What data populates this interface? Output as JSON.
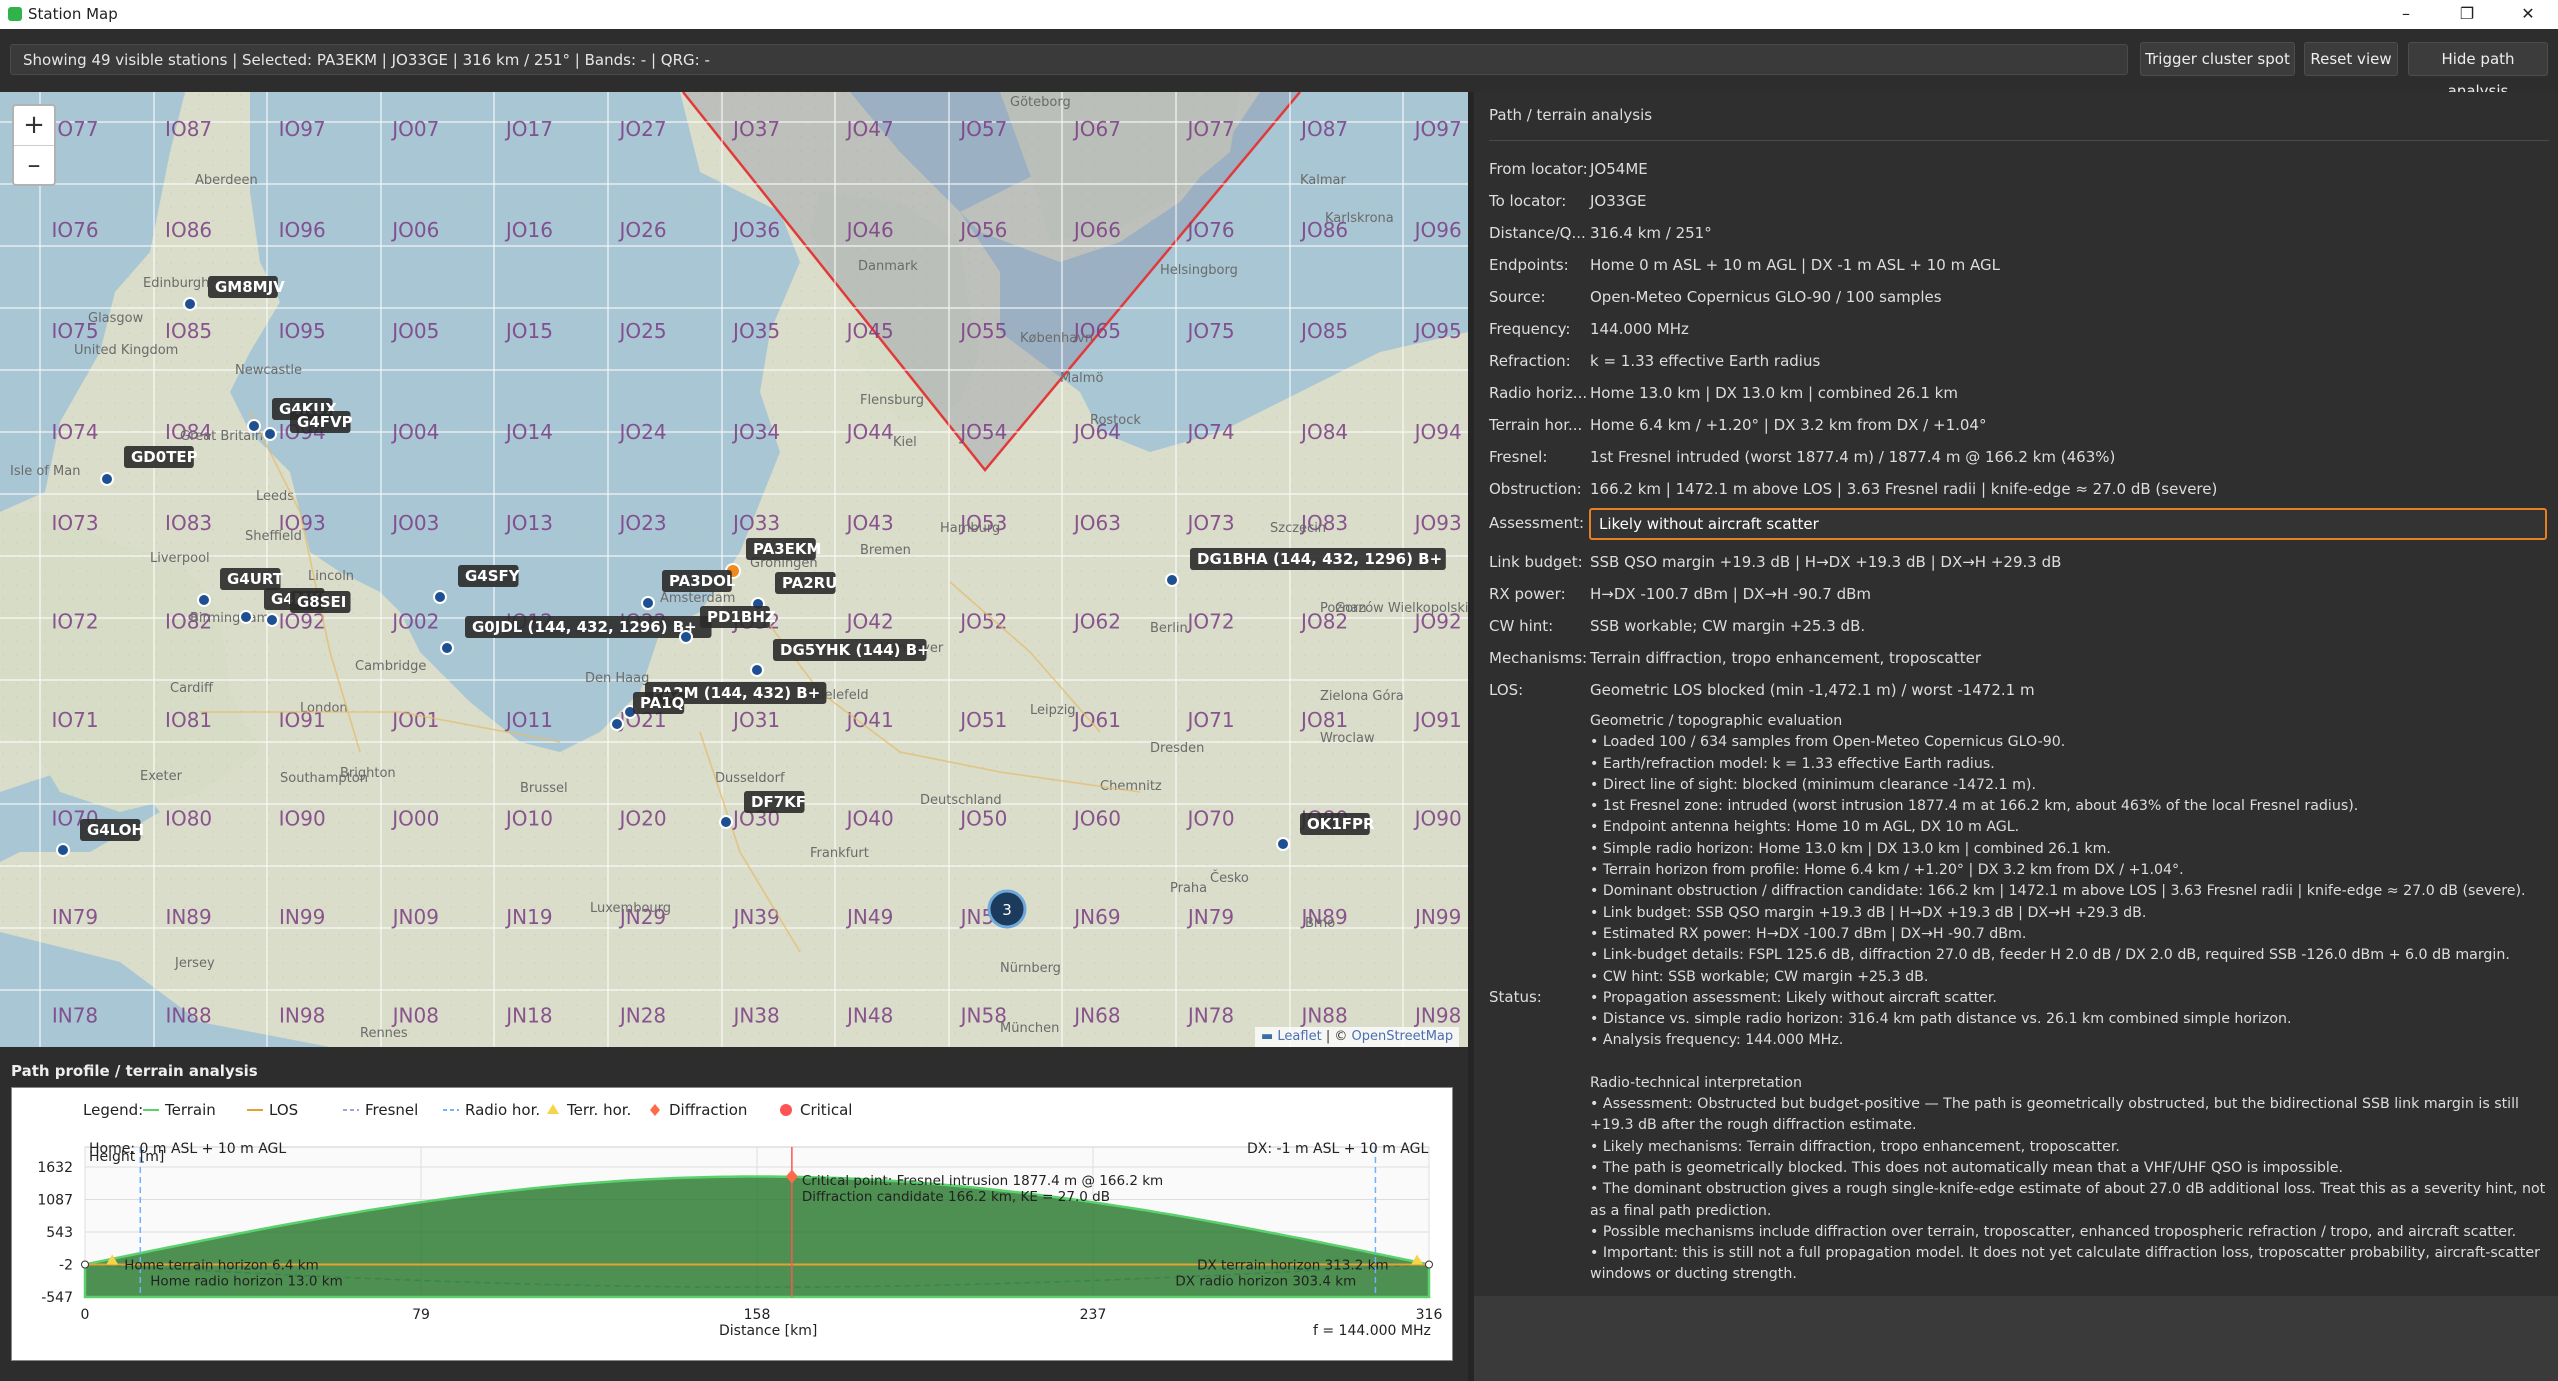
{
  "window": {
    "title": "Station Map",
    "minimize": "–",
    "maximize": "❐",
    "close": "✕"
  },
  "toolbar": {
    "status": "Showing 49 visible stations | Selected: PA3EKM | JO33GE | 316 km / 251° | Bands: - | QRG: -",
    "buttons": [
      "Trigger cluster spot",
      "Reset view",
      "Hide path analysis"
    ]
  },
  "map": {
    "zoom_in": "+",
    "zoom_out": "–",
    "attribution_leaflet": "Leaflet",
    "attribution_sep": " | © ",
    "attribution_osm": "OpenStreetMap",
    "grid_rows": [
      [
        "IO77",
        "IO87",
        "IO97",
        "JO07",
        "JO17",
        "JO27",
        "JO37",
        "JO47",
        "JO57",
        "JO67",
        "JO77",
        "JO87",
        "JO97"
      ],
      [
        "IO76",
        "IO86",
        "IO96",
        "JO06",
        "JO16",
        "JO26",
        "JO36",
        "JO46",
        "JO56",
        "JO66",
        "JO76",
        "JO86",
        "JO96"
      ],
      [
        "IO75",
        "IO85",
        "IO95",
        "JO05",
        "JO15",
        "JO25",
        "JO35",
        "JO45",
        "JO55",
        "JO65",
        "JO75",
        "JO85",
        "JO95"
      ],
      [
        "IO74",
        "IO84",
        "IO94",
        "JO04",
        "JO14",
        "JO24",
        "JO34",
        "JO44",
        "JO54",
        "JO64",
        "JO74",
        "JO84",
        "JO94"
      ],
      [
        "IO73",
        "IO83",
        "IO93",
        "JO03",
        "JO13",
        "JO23",
        "JO33",
        "JO43",
        "JO53",
        "JO63",
        "JO73",
        "JO83",
        "JO93"
      ],
      [
        "IO72",
        "IO82",
        "IO92",
        "JO02",
        "JO12",
        "JO22",
        "JO32",
        "JO42",
        "JO52",
        "JO62",
        "JO72",
        "JO82",
        "JO92"
      ],
      [
        "IO71",
        "IO81",
        "IO91",
        "JO01",
        "JO11",
        "JO21",
        "JO31",
        "JO41",
        "JO51",
        "JO61",
        "JO71",
        "JO81",
        "JO91"
      ],
      [
        "IO70",
        "IO80",
        "IO90",
        "JO00",
        "JO10",
        "JO20",
        "JO30",
        "JO40",
        "JO50",
        "JO60",
        "JO70",
        "JO80",
        "JO90"
      ],
      [
        "IN79",
        "IN89",
        "IN99",
        "JN09",
        "JN19",
        "JN29",
        "JN39",
        "JN49",
        "JN59",
        "JN69",
        "JN79",
        "JN89",
        "JN99"
      ],
      [
        "IN78",
        "IN88",
        "IN98",
        "JN08",
        "JN18",
        "JN28",
        "JN38",
        "JN48",
        "JN58",
        "JN68",
        "JN78",
        "JN88",
        "JN98"
      ]
    ],
    "places": [
      "Aberdeen",
      "Edinburgh",
      "Glasgow",
      "United Kingdom",
      "Newcastle",
      "Isle of Man",
      "Great Britain",
      "Leeds",
      "Liverpool",
      "Sheffield",
      "Lincoln",
      "Birmingham",
      "Cambridge",
      "Cardiff",
      "London",
      "Brighton",
      "Southampton",
      "Exeter",
      "Rennes",
      "Jersey",
      "Göteborg",
      "Danmark",
      "Helsingborg",
      "København",
      "Flensburg",
      "Kiel",
      "Hamburg",
      "Bremen",
      "Groningen",
      "Amsterdam",
      "Den Haag",
      "Bielefeld",
      "Dusseldorf",
      "Deutschland",
      "Leipzig",
      "Dresden",
      "Berlin",
      "Chemnitz",
      "Praha",
      "Nürnberg",
      "Frankfurt",
      "München",
      "Luxembourg",
      "Brussel",
      "Wroclaw",
      "Poznan",
      "Szczecin",
      "Gorzów Wielkopolski",
      "Zielona Góra",
      "Kalmar",
      "Karlskrona",
      "Malmö",
      "Rostock",
      "Hannover",
      "Česko",
      "Brno"
    ],
    "stations": [
      {
        "call": "GM8MJV"
      },
      {
        "call": "G4KUX"
      },
      {
        "call": "G4FVP"
      },
      {
        "call": "GD0TEP"
      },
      {
        "call": "G4URT"
      },
      {
        "call": "G4MKB"
      },
      {
        "call": "G8SEI"
      },
      {
        "call": "G4SFY"
      },
      {
        "call": "G0JDL (144, 432, 1296) B+"
      },
      {
        "call": "PA3EKM"
      },
      {
        "call": "PA3DOL"
      },
      {
        "call": "PA2RU"
      },
      {
        "call": "PD1BHZ"
      },
      {
        "call": "DG5YHK (144) B+"
      },
      {
        "call": "PA2M (144, 432) B+"
      },
      {
        "call": "PA1Q"
      },
      {
        "call": "DF7KF"
      },
      {
        "call": "G4LOH"
      },
      {
        "call": "DG1BHA (144, 432, 1296) B+"
      },
      {
        "call": "OK1FPR"
      }
    ],
    "cluster_count": "3"
  },
  "profile": {
    "title": "Path profile / terrain analysis",
    "legend_label": "Legend:",
    "legend": [
      {
        "name": "Terrain",
        "color": "#5bd16e",
        "style": "solid"
      },
      {
        "name": "LOS",
        "color": "#e8a030",
        "style": "solid"
      },
      {
        "name": "Fresnel",
        "color": "#9aa7d6",
        "style": "dashed"
      },
      {
        "name": "Radio hor.",
        "color": "#6fb3ff",
        "style": "dashed"
      },
      {
        "name": "Terr. hor.",
        "color": "#f5d44a",
        "style": "triangle"
      },
      {
        "name": "Diffraction",
        "color": "#ff6b4a",
        "style": "diamond"
      },
      {
        "name": "Critical",
        "color": "#ff5555",
        "style": "dot"
      }
    ],
    "home_label": "Home: 0 m ASL + 10 m AGL",
    "dx_label": "DX: -1 m ASL + 10 m AGL",
    "height_label": "Height [m]",
    "y_ticks": [
      "1632",
      "1087",
      "543",
      "-2",
      "-547"
    ],
    "x_ticks": [
      "0",
      "79",
      "158",
      "237",
      "316"
    ],
    "xlabel": "Distance [km]",
    "freq": "f = 144.000 MHz",
    "critical1": "Critical point: Fresnel intrusion 1877.4 m @ 166.2 km",
    "critical2": "Diffraction candidate 166.2 km, KE = 27.0 dB",
    "home_terr": "Home terrain horizon 6.4 km",
    "home_radio": "Home radio horizon 13.0 km",
    "dx_terr": "DX terrain horizon 313.2 km",
    "dx_radio": "DX radio horizon 303.4 km"
  },
  "analysis": {
    "title": "Path / terrain analysis",
    "rows": [
      {
        "label": "From locator:",
        "value": "JO54ME"
      },
      {
        "label": "To locator:",
        "value": "JO33GE"
      },
      {
        "label": "Distance/Q...",
        "value": "316.4 km / 251°"
      },
      {
        "label": "Endpoints:",
        "value": "Home 0 m ASL + 10 m AGL | DX -1 m ASL + 10 m AGL"
      },
      {
        "label": "Source:",
        "value": "Open-Meteo Copernicus GLO-90 / 100 samples"
      },
      {
        "label": "Frequency:",
        "value": "144.000 MHz"
      },
      {
        "label": "Refraction:",
        "value": "k = 1.33 effective Earth radius"
      },
      {
        "label": "Radio horiz...",
        "value": "Home 13.0 km | DX 13.0 km | combined 26.1 km"
      },
      {
        "label": "Terrain hor...",
        "value": "Home 6.4 km / +1.20° | DX 3.2 km from DX / +1.04°"
      },
      {
        "label": "Fresnel:",
        "value": "1st Fresnel intruded (worst 1877.4 m) / 1877.4 m @ 166.2 km (463%)"
      },
      {
        "label": "Obstruction:",
        "value": "166.2 km | 1472.1 m above LOS | 3.63 Fresnel radii | knife-edge ≈ 27.0 dB (severe)"
      }
    ],
    "assessment_label": "Assessment:",
    "assessment": "Likely without aircraft scatter",
    "rows2": [
      {
        "label": "Link budget:",
        "value": "SSB QSO margin +19.3 dB | H→DX +19.3 dB | DX→H +29.3 dB"
      },
      {
        "label": "RX power:",
        "value": "H→DX -100.7 dBm | DX→H -90.7 dBm"
      },
      {
        "label": "CW hint:",
        "value": "SSB workable; CW margin +25.3 dB."
      },
      {
        "label": "Mechanisms:",
        "value": "Terrain diffraction, tropo enhancement, troposcatter"
      },
      {
        "label": "LOS:",
        "value": "Geometric LOS blocked (min -1,472.1 m) / worst -1472.1 m"
      }
    ],
    "status_label": "Status:",
    "status_lines": [
      "Geometric / topographic evaluation",
      "• Loaded 100 / 634 samples from Open-Meteo Copernicus GLO-90.",
      "• Earth/refraction model: k = 1.33 effective Earth radius.",
      "• Direct line of sight: blocked (minimum clearance -1472.1 m).",
      "• 1st Fresnel zone: intruded (worst intrusion 1877.4 m at 166.2 km, about 463% of the local Fresnel radius).",
      "• Endpoint antenna heights: Home 10 m AGL, DX 10 m AGL.",
      "• Simple radio horizon: Home 13.0 km | DX 13.0 km | combined 26.1 km.",
      "• Terrain horizon from profile: Home 6.4 km / +1.20° | DX 3.2 km from DX / +1.04°.",
      "• Dominant obstruction / diffraction candidate: 166.2 km | 1472.1 m above LOS | 3.63 Fresnel radii | knife-edge ≈ 27.0 dB (severe).",
      "• Link budget: SSB QSO margin +19.3 dB | H→DX +19.3 dB | DX→H +29.3 dB.",
      "• Estimated RX power: H→DX -100.7 dBm | DX→H -90.7 dBm.",
      "• Link-budget details: FSPL 125.6 dB, diffraction 27.0 dB, feeder H 2.0 dB / DX 2.0 dB, required SSB -126.0 dBm + 6.0 dB margin.",
      "• CW hint: SSB workable; CW margin +25.3 dB.",
      "• Propagation assessment: Likely without aircraft scatter.",
      "• Distance vs. simple radio horizon: 316.4 km path distance vs. 26.1 km combined simple horizon.",
      "• Analysis frequency: 144.000 MHz.",
      "",
      "Radio-technical interpretation",
      "• Assessment: Obstructed but budget-positive — The path is geometrically obstructed, but the bidirectional SSB link margin is still +19.3 dB after the rough diffraction estimate.",
      "• Likely mechanisms: Terrain diffraction, tropo enhancement, troposcatter.",
      "• The path is geometrically blocked. This does not automatically mean that a VHF/UHF QSO is impossible.",
      "• The dominant obstruction gives a rough single-knife-edge estimate of about 27.0 dB additional loss. Treat this as a severity hint, not as a final path prediction.",
      "• Possible mechanisms include diffraction over terrain, troposcatter, enhanced tropospheric refraction / tropo, and aircraft scatter.",
      "• Important: this is still not a full propagation model. It does not yet calculate diffraction loss, troposcatter probability, aircraft-scatter windows or ducting strength."
    ]
  }
}
